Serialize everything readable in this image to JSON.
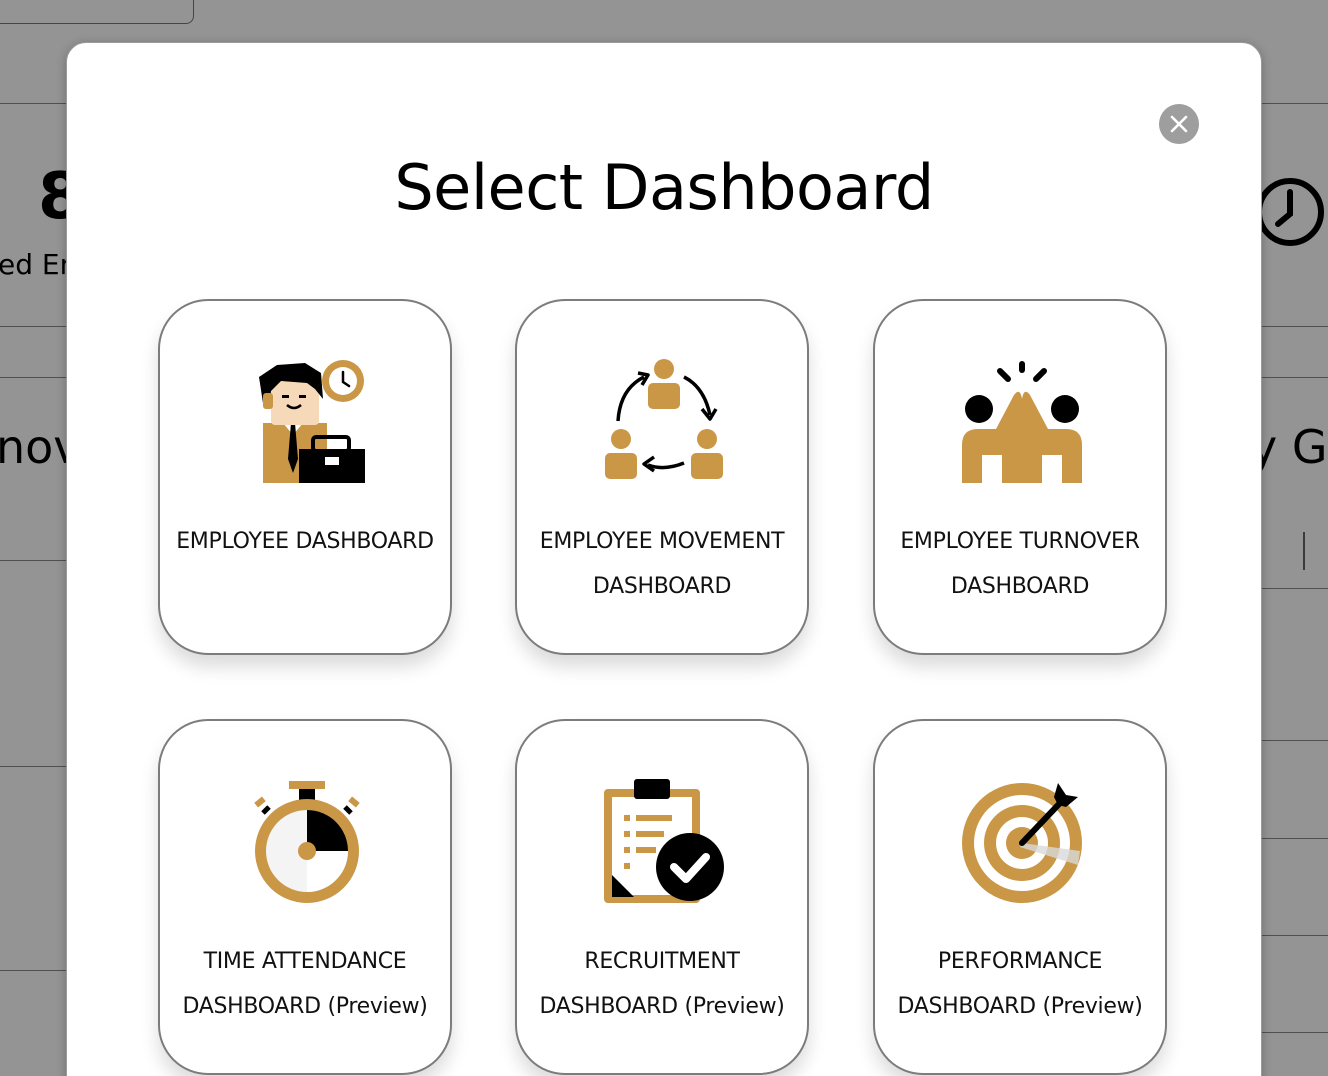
{
  "background": {
    "stat_number": "8",
    "stat_label": "ed Em",
    "heading_left": "nov",
    "heading_right": "y Gr",
    "dots": ".",
    "clock_icon": "clock-icon"
  },
  "modal": {
    "title": "Select Dashboard",
    "close_icon": "close-icon"
  },
  "colors": {
    "accent": "#C99746",
    "icon_dark": "#000000",
    "skin": "#F5D9B8",
    "close_button": "#9E9E9E",
    "card_border": "#7C7C7C"
  },
  "dashboards": [
    {
      "label": "EMPLOYEE DASHBOARD",
      "icon": "employee-icon"
    },
    {
      "label": "EMPLOYEE MOVEMENT DASHBOARD",
      "icon": "movement-cycle-icon"
    },
    {
      "label": "EMPLOYEE TURNOVER DASHBOARD",
      "icon": "high-five-icon"
    },
    {
      "label": "TIME ATTENDANCE DASHBOARD (Preview)",
      "icon": "stopwatch-icon"
    },
    {
      "label": "RECRUITMENT DASHBOARD (Preview)",
      "icon": "clipboard-check-icon"
    },
    {
      "label": "PERFORMANCE DASHBOARD (Preview)",
      "icon": "target-icon"
    }
  ]
}
